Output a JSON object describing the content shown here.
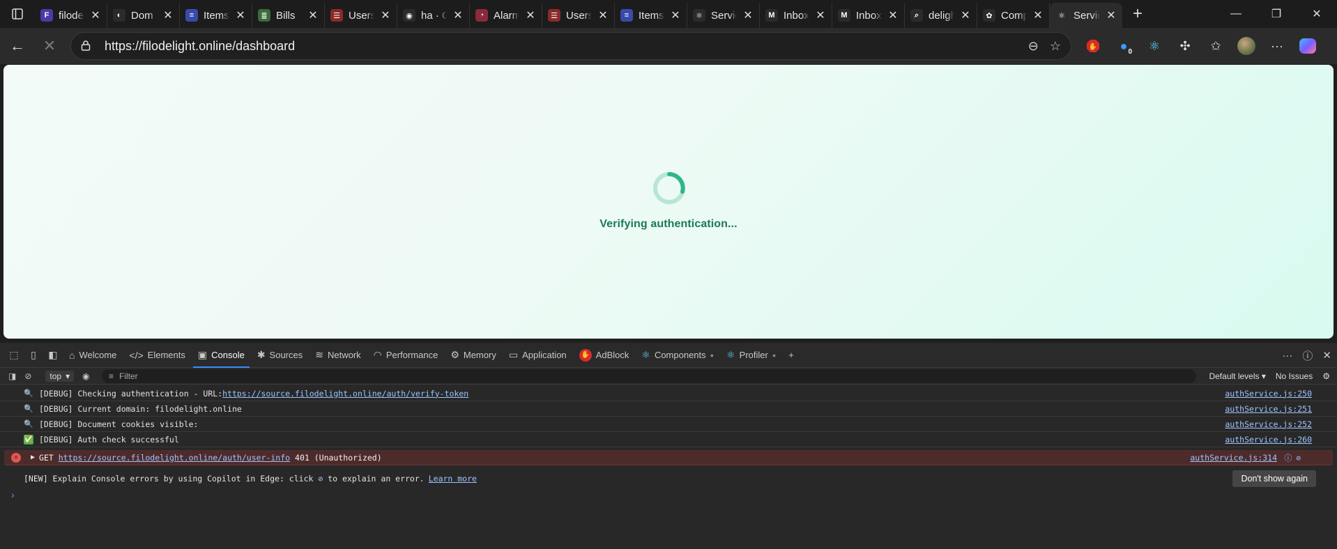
{
  "tabs": [
    {
      "title": "filodelight",
      "color": "#4b3aa8",
      "glyph": "F",
      "active": false
    },
    {
      "title": "Dom",
      "color": "#2b2b2b",
      "glyph": "◐",
      "active": false
    },
    {
      "title": "Items",
      "color": "#3a4aa8",
      "glyph": "≡",
      "active": false
    },
    {
      "title": "Bills",
      "color": "#3b6a3a",
      "glyph": "≣",
      "active": false
    },
    {
      "title": "Users",
      "color": "#8a2a2a",
      "glyph": "☰",
      "active": false
    },
    {
      "title": "ha · GitHub",
      "color": "#2b2b2b",
      "glyph": "◉",
      "active": false
    },
    {
      "title": "Alarms",
      "color": "#8a2a3a",
      "glyph": "◔",
      "active": false
    },
    {
      "title": "Users",
      "color": "#8a2a2a",
      "glyph": "☰",
      "active": false
    },
    {
      "title": "Items",
      "color": "#3a4aa8",
      "glyph": "≡",
      "active": false
    },
    {
      "title": "Services",
      "color": "#2b2b2b",
      "glyph": "⚛",
      "active": false
    },
    {
      "title": "Inbox",
      "color": "#2b2b2b",
      "glyph": "M",
      "active": false
    },
    {
      "title": "Inbox",
      "color": "#2b2b2b",
      "glyph": "M",
      "active": false
    },
    {
      "title": "delight",
      "color": "#2b2b2b",
      "glyph": "⌕",
      "active": false
    },
    {
      "title": "Components",
      "color": "#2b2b2b",
      "glyph": "✿",
      "active": false
    },
    {
      "title": "Services",
      "color": "#2b2b2b",
      "glyph": "⚛",
      "active": true
    }
  ],
  "address": {
    "url": "https://filodelight.online/dashboard"
  },
  "extensions": {
    "badge_count": "0"
  },
  "page": {
    "loading_text": "Verifying authentication...",
    "spinner_color": "#2fb58a"
  },
  "devtools": {
    "tabs": [
      {
        "label": "Welcome",
        "icon": "⌂"
      },
      {
        "label": "Elements",
        "icon": "</>"
      },
      {
        "label": "Console",
        "icon": "▣"
      },
      {
        "label": "Sources",
        "icon": "✱"
      },
      {
        "label": "Network",
        "icon": "≋"
      },
      {
        "label": "Performance",
        "icon": "◠"
      },
      {
        "label": "Memory",
        "icon": "⚙"
      },
      {
        "label": "Application",
        "icon": "▭"
      },
      {
        "label": "AdBlock",
        "icon": "✋"
      },
      {
        "label": "Components",
        "icon": "⚛"
      },
      {
        "label": "Profiler",
        "icon": "⚛"
      }
    ],
    "context": "top",
    "filter_placeholder": "Filter",
    "levels": "Default levels",
    "issues": "No Issues",
    "logs": [
      {
        "icon": "🔍",
        "text": "[DEBUG] Checking authentication - URL: ",
        "link": "https://source.filodelight.online/auth/verify-token",
        "source": "authService.js:250"
      },
      {
        "icon": "🔍",
        "text": "[DEBUG] Current domain: filodelight.online",
        "link": "",
        "source": "authService.js:251"
      },
      {
        "icon": "🔍",
        "text": "[DEBUG] Document cookies visible:",
        "link": "",
        "source": "authService.js:252"
      },
      {
        "icon": "✅",
        "text": "[DEBUG] Auth check successful",
        "link": "",
        "source": "authService.js:260"
      }
    ],
    "error": {
      "method": "GET",
      "link": "https://source.filodelight.online/auth/user-info",
      "status": "401 (Unauthorized)",
      "source": "authService.js:314"
    },
    "tip": {
      "text_before": "[NEW] Explain Console errors by using Copilot in Edge: click",
      "text_after": "to explain an error.",
      "link": "Learn more",
      "button": "Don't show again"
    }
  }
}
